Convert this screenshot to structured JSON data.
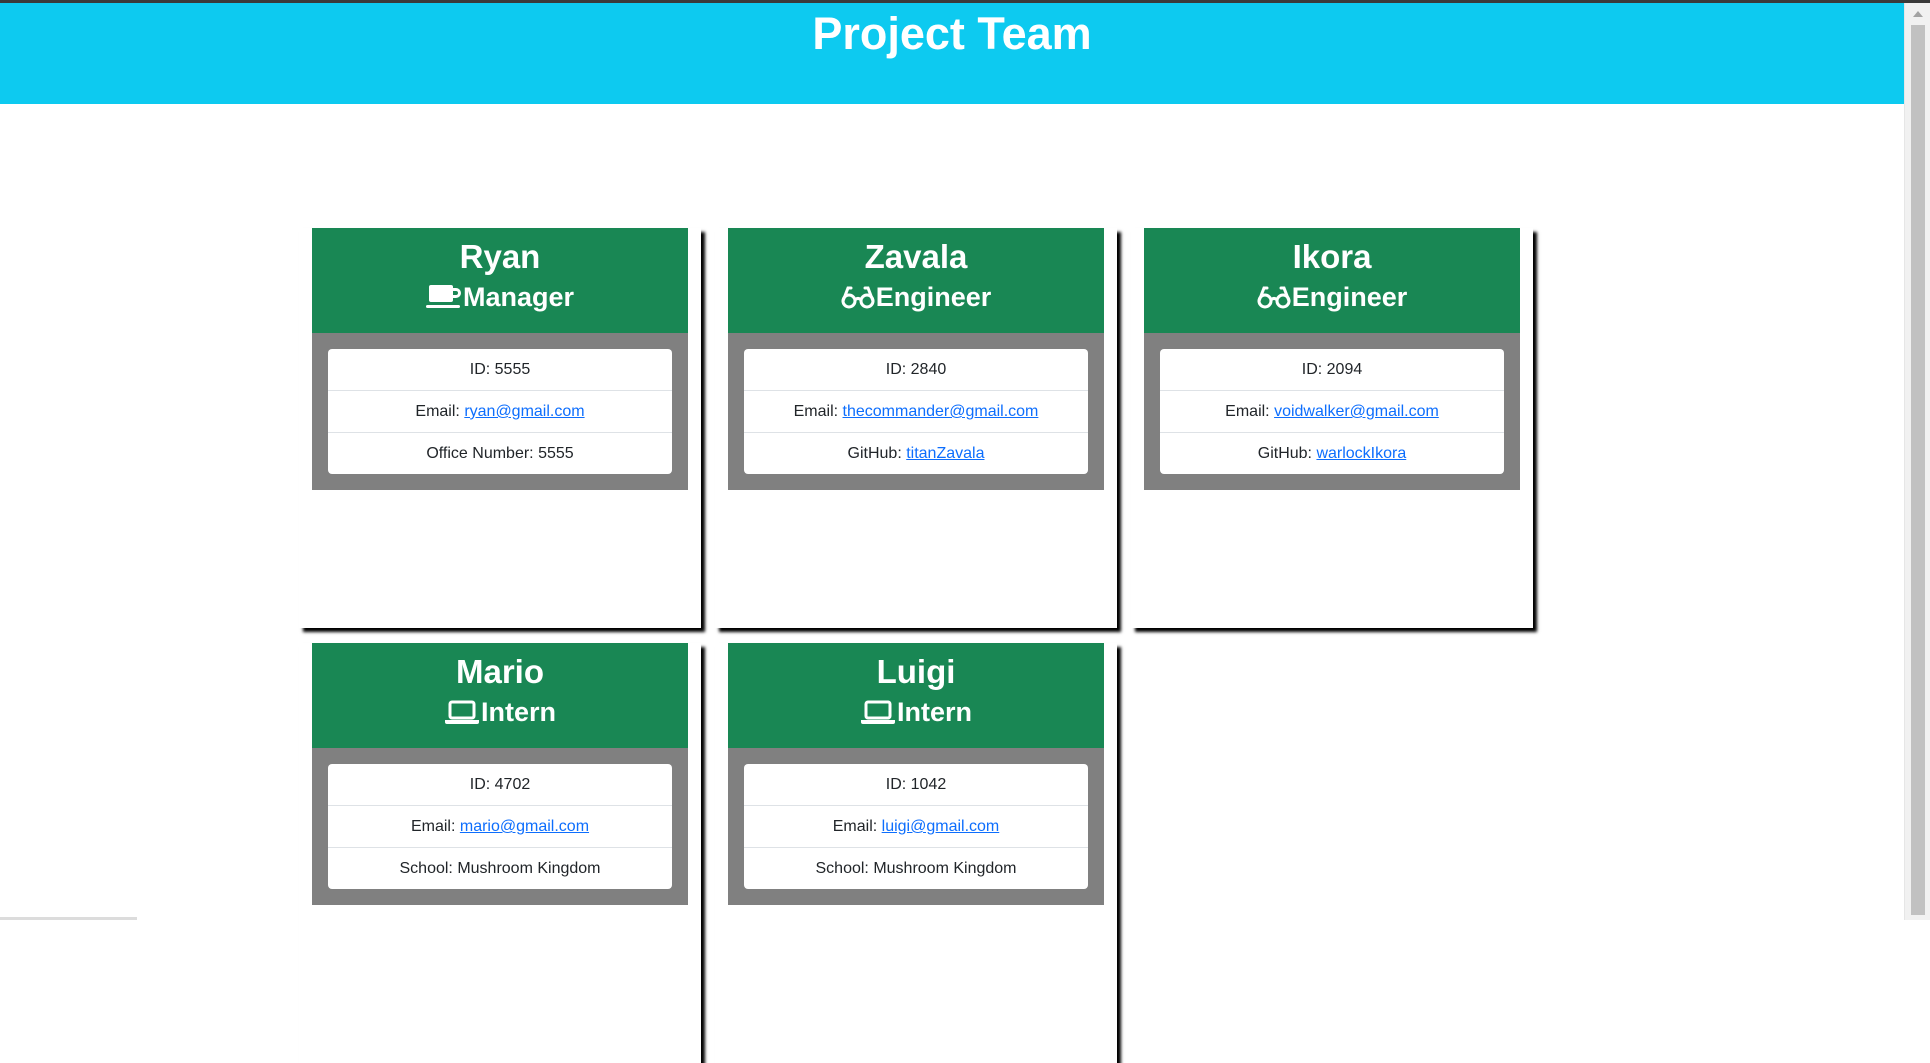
{
  "page": {
    "title": "Project Team"
  },
  "colors": {
    "header_bg": "#0dcaf0",
    "card_head_bg": "#198754",
    "card_body_bg": "#808080",
    "link": "#0d6efd"
  },
  "employees": [
    {
      "name": "Ryan",
      "role": "Manager",
      "icon": "coffee-icon",
      "id_label": "ID: 5555",
      "email_prefix": "Email: ",
      "email": "ryan@gmail.com",
      "extra_prefix": "Office Number: ",
      "extra_value": "5555",
      "extra_is_link": false
    },
    {
      "name": "Zavala",
      "role": "Engineer",
      "icon": "glasses-icon",
      "id_label": "ID: 2840",
      "email_prefix": "Email: ",
      "email": "thecommander@gmail.com",
      "extra_prefix": "GitHub: ",
      "extra_value": "titanZavala",
      "extra_is_link": true
    },
    {
      "name": "Ikora",
      "role": "Engineer",
      "icon": "glasses-icon",
      "id_label": "ID: 2094",
      "email_prefix": "Email: ",
      "email": "voidwalker@gmail.com",
      "extra_prefix": "GitHub: ",
      "extra_value": "warlockIkora",
      "extra_is_link": true
    },
    {
      "name": "Mario",
      "role": "Intern",
      "icon": "laptop-icon",
      "id_label": "ID: 4702",
      "email_prefix": "Email: ",
      "email": "mario@gmail.com",
      "extra_prefix": "School: ",
      "extra_value": "Mushroom Kingdom",
      "extra_is_link": false
    },
    {
      "name": "Luigi",
      "role": "Intern",
      "icon": "laptop-icon",
      "id_label": "ID: 1042",
      "email_prefix": "Email: ",
      "email": "luigi@gmail.com",
      "extra_prefix": "School: ",
      "extra_value": "Mushroom Kingdom",
      "extra_is_link": false
    }
  ]
}
